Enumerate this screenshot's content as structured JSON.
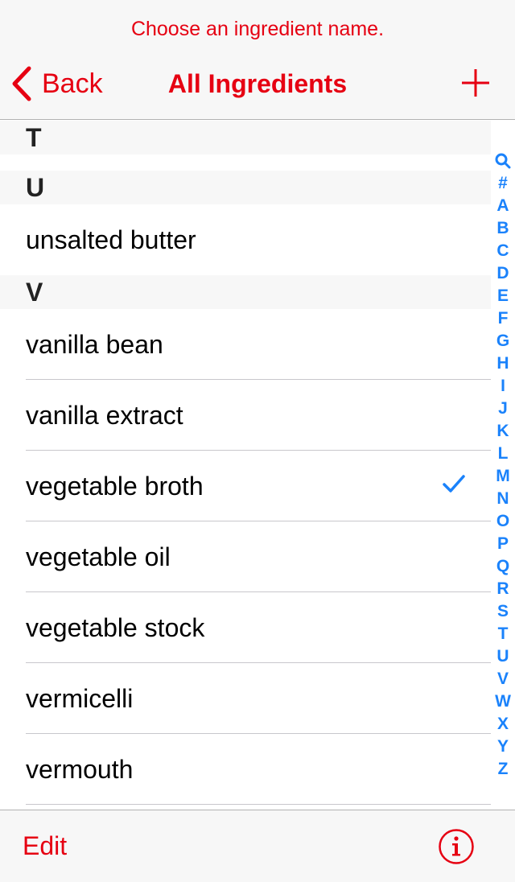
{
  "nav": {
    "prompt": "Choose an ingredient name.",
    "back_label": "Back",
    "title": "All Ingredients"
  },
  "sections": [
    {
      "letter": "T",
      "items": []
    },
    {
      "letter": "U",
      "items": [
        "unsalted butter"
      ]
    },
    {
      "letter": "V",
      "items": [
        "vanilla bean",
        "vanilla extract",
        "vegetable broth",
        "vegetable oil",
        "vegetable stock",
        "vermicelli",
        "vermouth"
      ]
    }
  ],
  "selected_item": "vegetable broth",
  "index": [
    "search-icon",
    "#",
    "A",
    "B",
    "C",
    "D",
    "E",
    "F",
    "G",
    "H",
    "I",
    "J",
    "K",
    "L",
    "M",
    "N",
    "O",
    "P",
    "Q",
    "R",
    "S",
    "T",
    "U",
    "V",
    "W",
    "X",
    "Y",
    "Z"
  ],
  "toolbar": {
    "edit_label": "Edit"
  },
  "colors": {
    "accent": "#e60012",
    "index": "#1a82fb",
    "check": "#1a82fb",
    "bar_bg": "#f7f7f7"
  }
}
